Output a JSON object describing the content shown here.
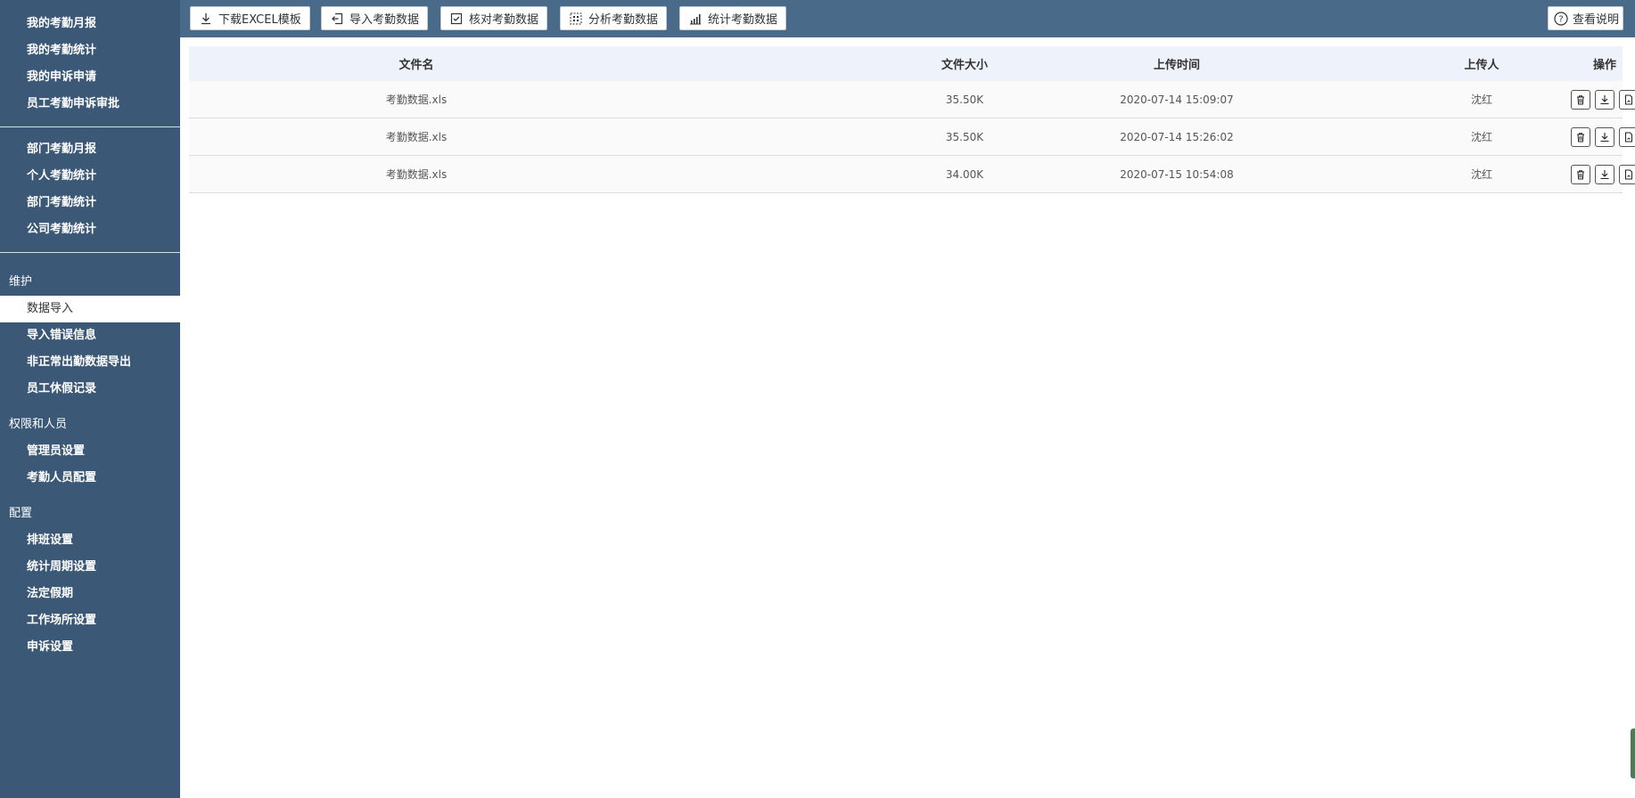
{
  "sidebar": {
    "group1": [
      "我的考勤月报",
      "我的考勤统计",
      "我的申诉申请",
      "员工考勤申诉审批"
    ],
    "group2": [
      "部门考勤月报",
      "个人考勤统计",
      "部门考勤统计",
      "公司考勤统计"
    ],
    "section_maintenance": "维护",
    "maintenance": [
      "数据导入",
      "导入错误信息",
      "非正常出勤数据导出",
      "员工休假记录"
    ],
    "section_permissions": "权限和人员",
    "permissions": [
      "管理员设置",
      "考勤人员配置"
    ],
    "section_config": "配置",
    "config": [
      "排班设置",
      "统计周期设置",
      "法定假期",
      "工作场所设置",
      "申诉设置"
    ]
  },
  "toolbar": {
    "download_template": "下载EXCEL模板",
    "import_data": "导入考勤数据",
    "verify_data": "核对考勤数据",
    "analyze_data": "分析考勤数据",
    "stats_data": "统计考勤数据",
    "help": "查看说明"
  },
  "table": {
    "headers": {
      "name": "文件名",
      "size": "文件大小",
      "time": "上传时间",
      "user": "上传人",
      "op": "操作"
    },
    "rows": [
      {
        "name": "考勤数据.xls",
        "size": "35.50K",
        "time": "2020-07-14 15:09:07",
        "user": "沈红"
      },
      {
        "name": "考勤数据.xls",
        "size": "35.50K",
        "time": "2020-07-14 15:26:02",
        "user": "沈红"
      },
      {
        "name": "考勤数据.xls",
        "size": "34.00K",
        "time": "2020-07-15 10:54:08",
        "user": "沈红"
      }
    ]
  },
  "icons": {
    "delete": "trash-icon",
    "download": "download-icon",
    "view": "document-icon"
  },
  "colors": {
    "sidebar_bg": "#3b5877",
    "toolbar_bg": "#4a6a8a",
    "table_header_bg": "#eef2fb"
  }
}
